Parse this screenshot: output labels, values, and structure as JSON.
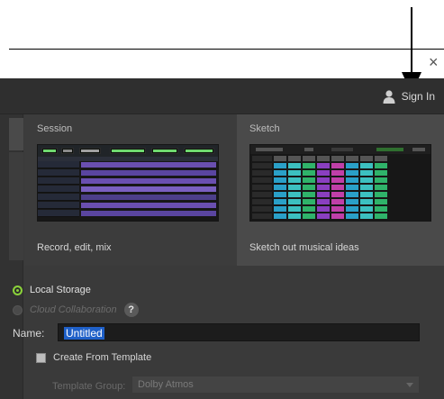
{
  "window": {
    "close_glyph": "×"
  },
  "header": {
    "sign_in_label": "Sign In",
    "sign_in_icon": "user-icon"
  },
  "templates": [
    {
      "title": "Session",
      "description": "Record, edit, mix"
    },
    {
      "title": "Sketch",
      "description": "Sketch out musical ideas"
    }
  ],
  "storage": {
    "local_label": "Local Storage",
    "local_selected": true,
    "cloud_label": "Cloud Collaboration",
    "cloud_enabled": false,
    "help_glyph": "?"
  },
  "name_field": {
    "label": "Name:",
    "value": "Untitled"
  },
  "template_option": {
    "label": "Create From Template",
    "checked": false
  },
  "template_group": {
    "label": "Template Group:",
    "value": "Dolby Atmos"
  },
  "colors": {
    "accent_green": "#8ad13a",
    "selection_blue": "#1f60c8",
    "session_clip": "#6a4fb0",
    "sketch_colors": [
      "#2aa0c8",
      "#3cc0c0",
      "#2fb36a",
      "#8a3fc0",
      "#c03fa8"
    ]
  }
}
